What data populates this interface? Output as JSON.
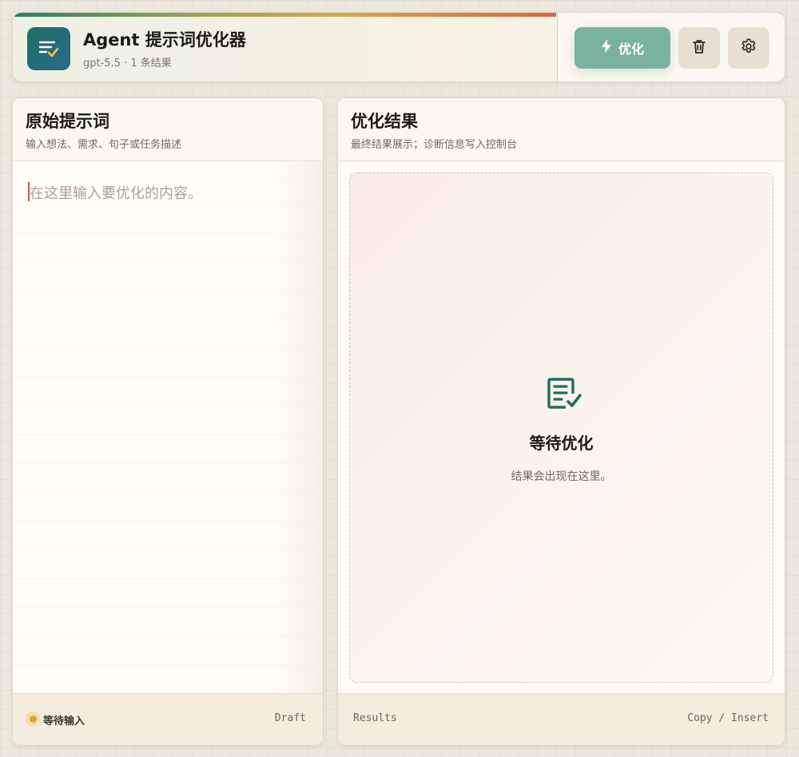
{
  "header": {
    "title": "Agent 提示词优化器",
    "subtitle": "gpt-5.5 · 1 条结果",
    "optimize_label": "优化",
    "app_icon": "list-check-icon",
    "optimize_icon": "bolt-icon",
    "delete_icon": "trash-icon",
    "settings_icon": "gear-icon"
  },
  "input_panel": {
    "title": "原始提示词",
    "subtitle": "输入想法、需求、句子或任务描述",
    "placeholder": "在这里输入要优化的内容。",
    "status": "等待输入",
    "footer_right": "Draft"
  },
  "result_panel": {
    "title": "优化结果",
    "subtitle": "最终结果展示；诊断信息写入控制台",
    "empty_icon": "document-check-icon",
    "empty_title": "等待优化",
    "empty_subtitle": "结果会出现在这里。",
    "footer_left": "Results",
    "footer_right": "Copy / Insert"
  },
  "colors": {
    "accent_green": "#79b3a0",
    "brand_teal": "#1f6f64",
    "status_amber": "#d9a640",
    "caret_red": "#c0584a"
  }
}
